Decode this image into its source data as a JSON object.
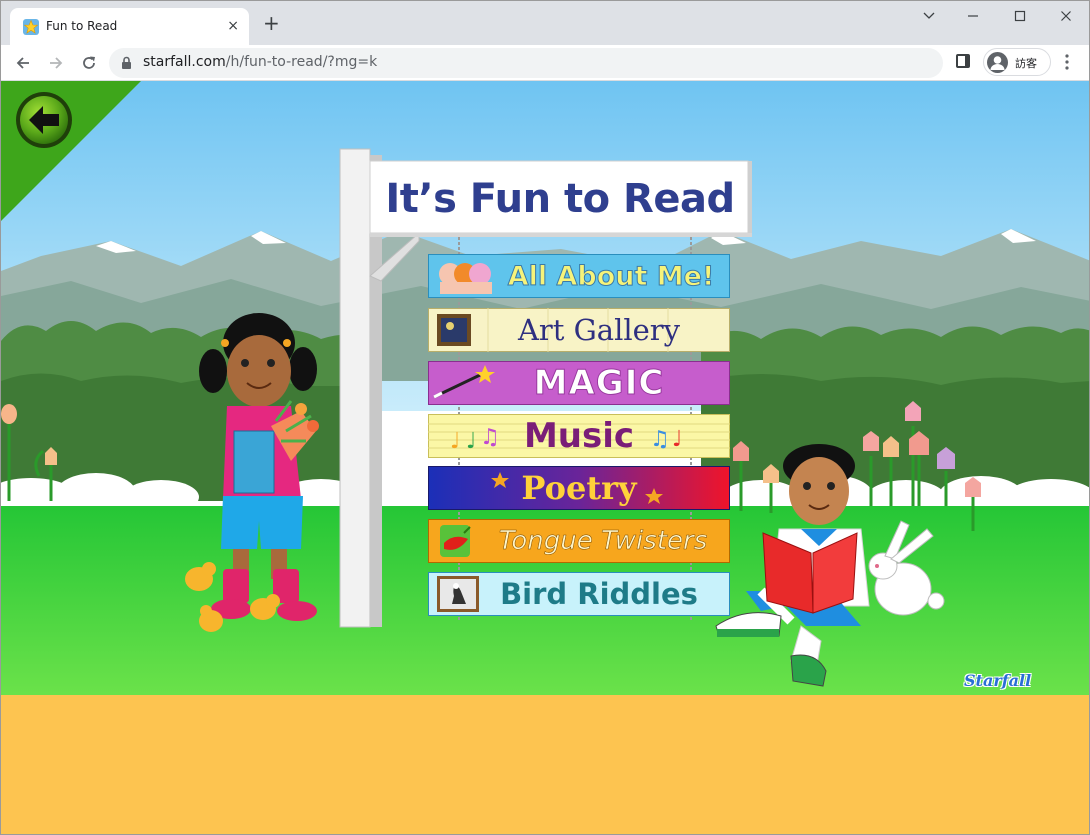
{
  "browser": {
    "tab_title": "Fun to Read",
    "tab_close": "×",
    "new_tab": "+",
    "url_host": "starfall.com",
    "url_path": "/h/fun-to-read/?mg=k",
    "profile_label": "訪客",
    "window_controls": {
      "minimize": "—",
      "maximize": "☐",
      "close": "✕"
    },
    "nav": {
      "back": "←",
      "forward": "→",
      "reload": "↻"
    },
    "menu": "⋮"
  },
  "page": {
    "title": "It’s Fun to Read",
    "logo": "Starfall",
    "colors": {
      "sky": "#8fd3f5",
      "grass": "#4cd643",
      "ground": "#fdc450",
      "back_corner": "#3ea61b",
      "title_text": "#2f3f8f"
    },
    "menu_items": [
      {
        "label": "All About Me!",
        "bg": "#5fc4ec",
        "color": "#f6f37a",
        "icon": "faces-icon"
      },
      {
        "label": "Art Gallery",
        "bg": "#f8f3c6",
        "color": "#2e2f80",
        "icon": "painting-icon"
      },
      {
        "label": "MAGIC",
        "bg": "#c65dcc",
        "color": "#ffffff",
        "icon": "magic-wand-icon"
      },
      {
        "label": "Music",
        "bg": "#fbf7a6",
        "color": "#7a1d78",
        "icon": "music-notes-icon"
      },
      {
        "label": "Poetry",
        "bg": "#2130b5",
        "color": "#ffd23a",
        "icon": "star-icon"
      },
      {
        "label": "Tongue Twisters",
        "bg": "#f7a61d",
        "color": "#fff6c8",
        "icon": "pepper-icon"
      },
      {
        "label": "Bird Riddles",
        "bg": "#c8f2fb",
        "color": "#1e7b88",
        "icon": "goose-icon"
      }
    ]
  }
}
